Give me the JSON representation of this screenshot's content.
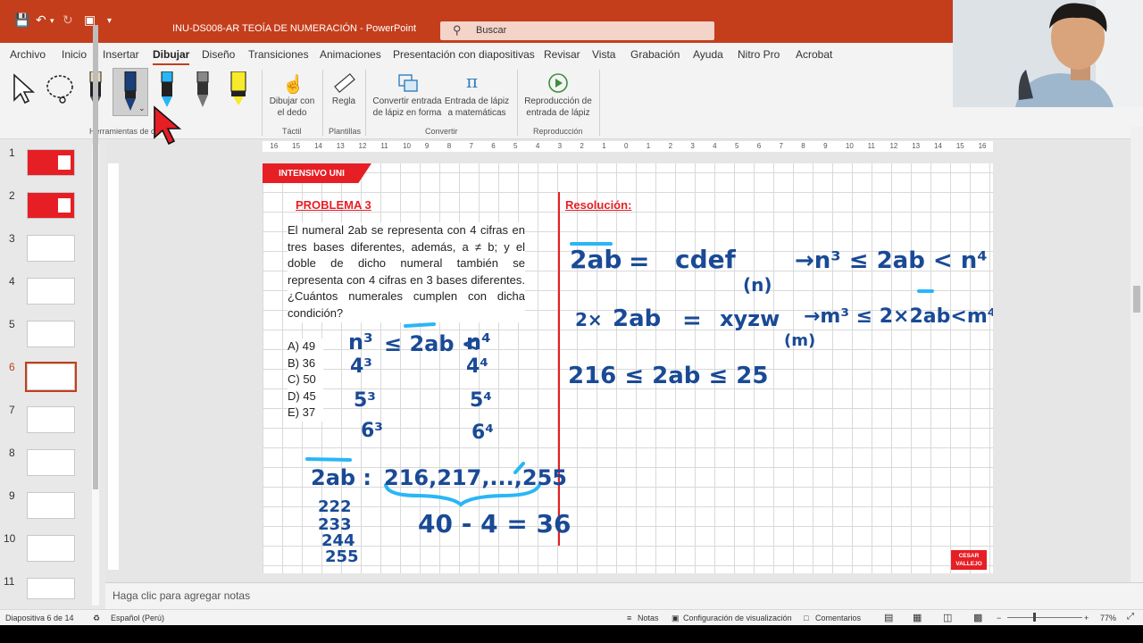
{
  "app": {
    "title": "INU-DS008-AR TEOÍA DE NUMERACIÓN  -  PowerPoint"
  },
  "search": {
    "label": "Buscar"
  },
  "colors": {
    "brand": "#c43e1c",
    "slide_red": "#e61f25",
    "ink_blue": "#1a4a96",
    "highlight_cyan": "#29b6f6"
  },
  "menu": {
    "tabs": [
      "Archivo",
      "Inicio",
      "Insertar",
      "Dibujar",
      "Diseño",
      "Transiciones",
      "Animaciones",
      "Presentación con diapositivas",
      "Revisar",
      "Vista",
      "Grabación",
      "Ayuda",
      "Nitro Pro",
      "Acrobat"
    ],
    "active": "Dibujar"
  },
  "ribbon": {
    "tools_group": "Herramientas de d",
    "draw_finger": "Dibujar con\nel dedo",
    "tactil_group": "Táctil",
    "ruler": "Regla",
    "plantillas_group": "Plantillas",
    "ink_to_shape": "Convertir entrada\nde lápiz en forma",
    "ink_to_math": "Entrada de lápiz\na matemáticas",
    "convertir_group": "Convertir",
    "replay": "Reproducción de\nentrada de lápiz",
    "reproduccion_group": "Reproducción"
  },
  "slides": {
    "numbers": [
      "1",
      "2",
      "3",
      "4",
      "5",
      "6",
      "7",
      "8",
      "9",
      "10",
      "11"
    ],
    "selected": "6"
  },
  "ruler": {
    "h_ticks": [
      "16",
      "15",
      "14",
      "13",
      "12",
      "11",
      "10",
      "9",
      "8",
      "7",
      "6",
      "5",
      "4",
      "3",
      "2",
      "1",
      "0",
      "1",
      "2",
      "3",
      "4",
      "5",
      "6",
      "7",
      "8",
      "9",
      "10",
      "11",
      "12",
      "13",
      "14",
      "15",
      "16"
    ]
  },
  "slide": {
    "header": "INTENSIVO UNI",
    "problem_title": "PROBLEMA 3",
    "problem_text": "El numeral 2ab se representa con 4 cifras en tres bases diferentes, además, a ≠ b; y el doble de dicho numeral también se representa con 4 cifras en 3 bases diferentes. ¿Cuántos numerales cumplen con dicha condición?",
    "options": [
      "A)  49",
      "B)  36",
      "C)  50",
      "D)  45",
      "E)  37"
    ],
    "resolution_title": "Resolución:",
    "logo": "CESAR\nVALLEJO"
  },
  "notes": {
    "placeholder": "Haga clic para agregar notas"
  },
  "status": {
    "slide_of": "Diapositiva 6 de 14",
    "language": "Español (Perú)",
    "notes": "Notas",
    "view_config": "Configuración de visualización",
    "comments": "Comentarios",
    "zoom": "77%"
  }
}
